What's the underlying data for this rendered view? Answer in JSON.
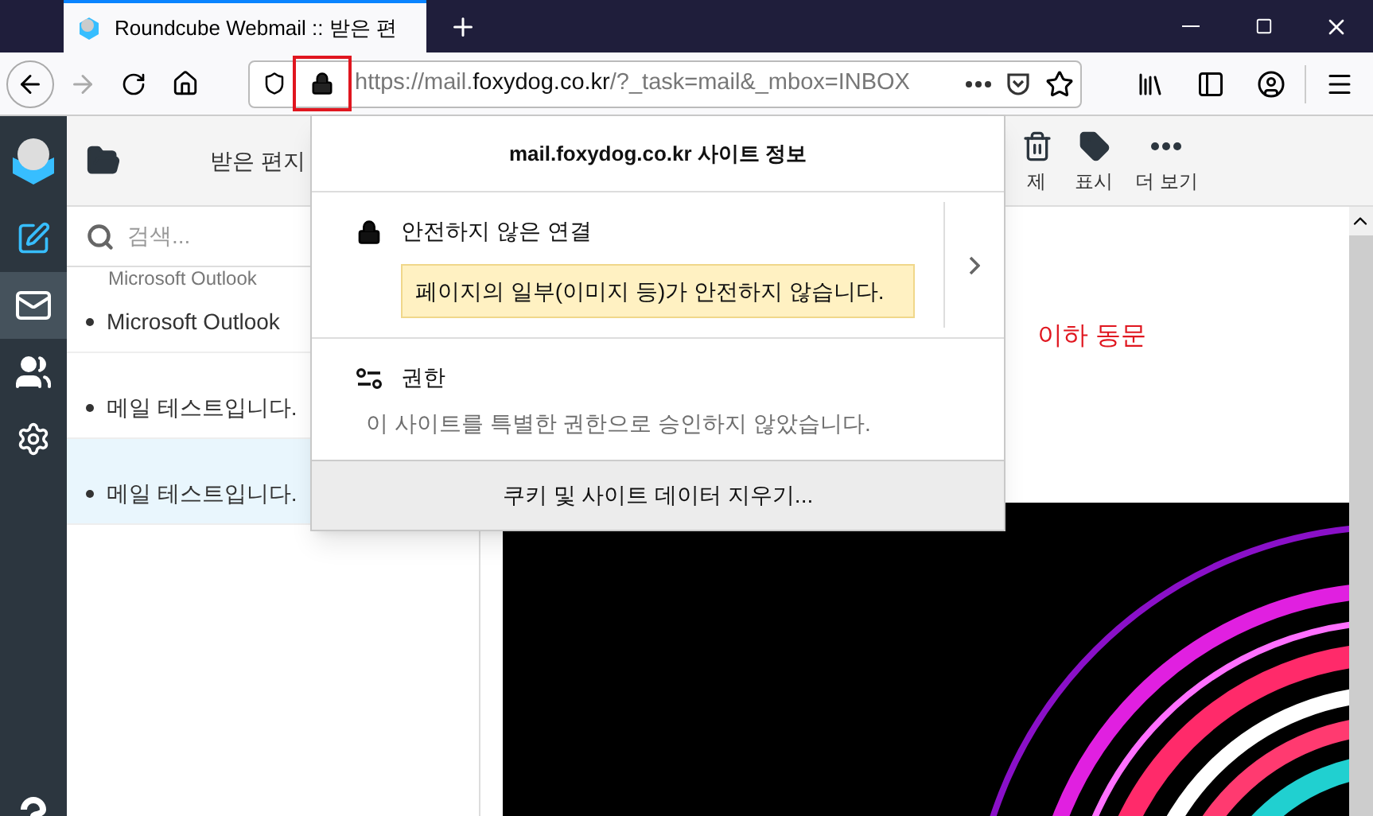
{
  "browser": {
    "tab": {
      "title": "Roundcube Webmail :: 받은 편",
      "selected": true
    },
    "url": {
      "prefix": "https://mail.",
      "domain": "foxydog.co.kr",
      "suffix": "/?_task=mail&_mbox=INBOX"
    }
  },
  "app": {
    "nav": [
      {
        "kind": "compose",
        "selected": false
      },
      {
        "kind": "mail",
        "selected": true
      },
      {
        "kind": "contacts",
        "selected": false
      },
      {
        "kind": "settings",
        "selected": false
      }
    ],
    "folder_title": "받은 편지",
    "toolbar": [
      {
        "kind": "delete",
        "label": "제"
      },
      {
        "kind": "mark",
        "label": "표시"
      },
      {
        "kind": "more",
        "label": "더 보기"
      }
    ],
    "search": {
      "placeholder": "검색..."
    },
    "messages": [
      {
        "from": "Microsoft Outlook",
        "subject": "Microsoft Outlook",
        "selected": false
      },
      {
        "subject": "메일 테스트입니다.",
        "selected": false
      },
      {
        "subject": "메일 테스트입니다.",
        "selected": true
      }
    ],
    "note": "이하 동문"
  },
  "site_info": {
    "title": "mail.foxydog.co.kr 사이트 정보",
    "connection": {
      "label": "안전하지 않은 연결",
      "warning": "페이지의 일부(이미지 등)가 안전하지 않습니다."
    },
    "permissions": {
      "label": "권한",
      "text": "이 사이트를 특별한 권한으로 승인하지 않았습니다."
    },
    "clear_button": "쿠키 및 사이트 데이터 지우기..."
  }
}
